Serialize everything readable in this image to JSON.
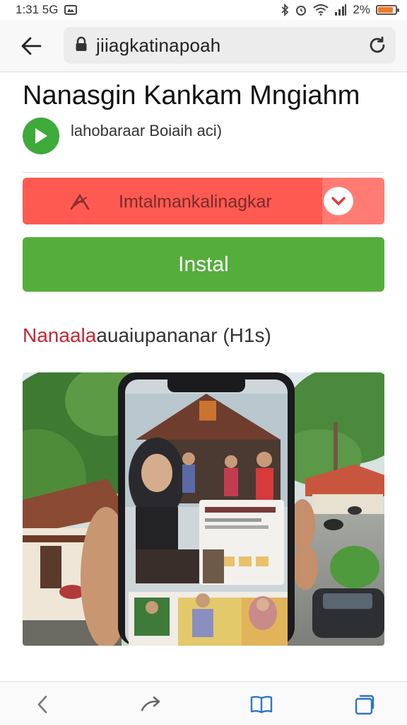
{
  "status_bar": {
    "time": "1:31 5G",
    "battery_text": "2%",
    "battery_level": 0.8,
    "battery_color": "#f07a22"
  },
  "browser": {
    "url_text": "jiiagkatinapoah",
    "icons": [
      "back-arrow-icon",
      "lock-icon",
      "reload-icon"
    ]
  },
  "app": {
    "title": "Nanasgin Kankam Mngiahm",
    "developer": "lahobaraar Boiaih aci)",
    "promo_text": "Imtalmankalinagkar",
    "install_label": "Instal"
  },
  "section": {
    "label_red": "Nanaala",
    "label_dark": "auaiupananar (H1s)"
  },
  "bottom_nav": {
    "icons": [
      "back-chevron-icon",
      "share-arrow-icon",
      "bookmarks-book-icon",
      "tabs-icon"
    ]
  },
  "colors": {
    "install_green": "#55ad3b",
    "promo_red": "#ff5a52",
    "play_green": "#3daa3a",
    "section_red": "#c62633",
    "link_blue": "#2d74c9"
  }
}
